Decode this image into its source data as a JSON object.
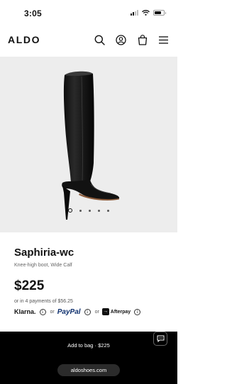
{
  "status_bar": {
    "time": "3:05"
  },
  "header": {
    "logo": "ALDO",
    "icons": [
      "search-icon",
      "account-icon",
      "bag-icon",
      "menu-icon"
    ]
  },
  "gallery": {
    "image_count": 5,
    "active_index": 0
  },
  "product": {
    "name": "Saphiria-wc",
    "description": "Knee-high boot, Wide Calf",
    "price": "$225",
    "installments": "or in 4 payments of $56.25"
  },
  "payment": {
    "klarna": "Klarna.",
    "paypal": "PayPal",
    "afterpay": "Afterpay",
    "or": "or",
    "info_glyph": "i",
    "afterpay_glyph": "→"
  },
  "actions": {
    "add_to_bag": "Add to bag · $225"
  },
  "browser": {
    "url": "aldoshoes.com"
  },
  "colors": {
    "bottom_bar": "#000000",
    "hero_bg": "#ededed",
    "paypal_blue": "#0d2f6d"
  }
}
